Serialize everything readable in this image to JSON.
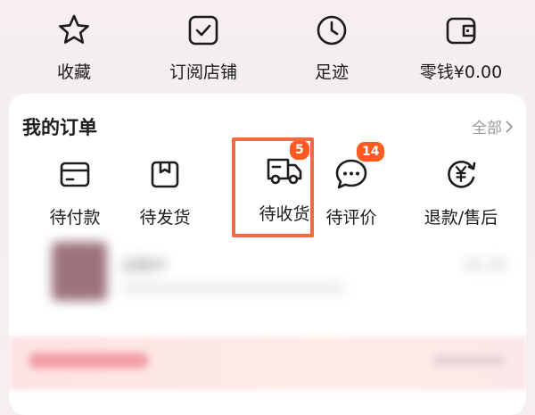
{
  "shortcuts": [
    {
      "label": "收藏",
      "icon": "star-icon"
    },
    {
      "label": "订阅店铺",
      "icon": "checkbox-icon"
    },
    {
      "label": "足迹",
      "icon": "clock-icon"
    },
    {
      "label": "零钱¥0.00",
      "icon": "wallet-icon"
    }
  ],
  "orders": {
    "title": "我的订单",
    "all_label": "全部",
    "items": [
      {
        "label": "待付款",
        "icon": "card-icon"
      },
      {
        "label": "待发货",
        "icon": "box-icon"
      },
      {
        "label": "待收货",
        "icon": "truck-icon",
        "badge": "5"
      },
      {
        "label": "待评价",
        "icon": "chat-bubble-icon",
        "badge": "14"
      },
      {
        "label": "退款/售后",
        "icon": "refund-icon"
      }
    ]
  },
  "recent_order": {
    "status": "运输中",
    "date": "01-25"
  },
  "colors": {
    "badge": "#ff5a1f",
    "highlight": "#f06b43",
    "icon_stroke": "#1c1c1c"
  }
}
